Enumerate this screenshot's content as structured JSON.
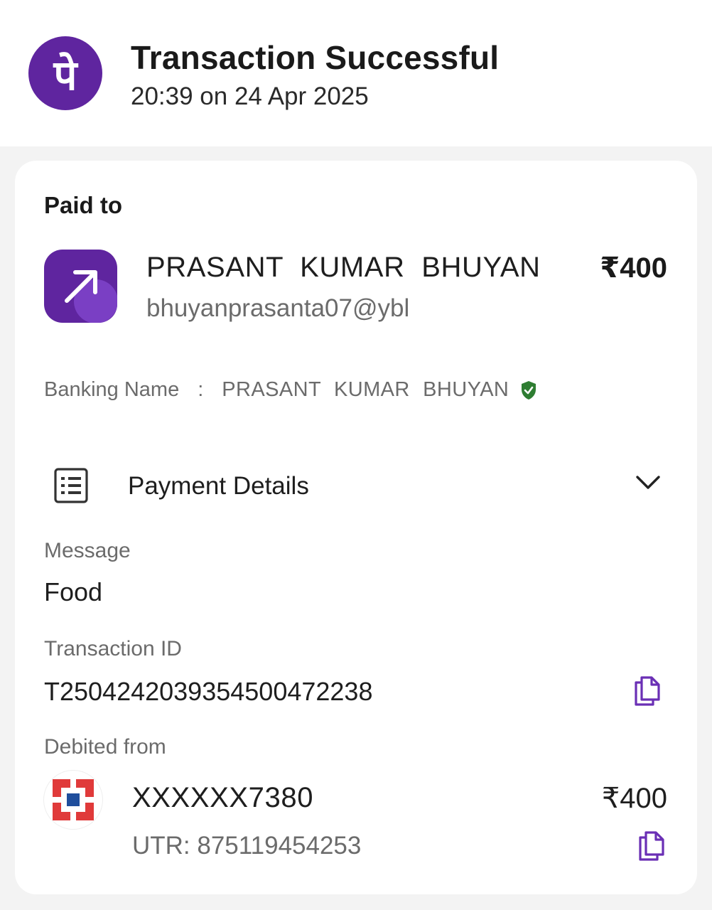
{
  "header": {
    "logo_glyph": "पे",
    "title": "Transaction Successful",
    "datetime": "20:39 on 24 Apr 2025",
    "brand_color": "#5f259f"
  },
  "paid_to": {
    "label": "Paid to",
    "icon": "arrow-up-right-icon",
    "name": "PRASANT KUMAR BHUYAN",
    "upi_id": "bhuyanprasanta07@ybl",
    "amount": "₹400"
  },
  "banking_name": {
    "label": "Banking Name",
    "separator": ":",
    "value": "PRASANT KUMAR BHUYAN",
    "verified_icon": "verified-shield-icon",
    "verified_color": "#2e7d32"
  },
  "payment_details": {
    "label": "Payment Details",
    "icon": "receipt-list-icon",
    "toggle_icon": "chevron-down-icon",
    "message_label": "Message",
    "message_value": "Food",
    "txn_label": "Transaction ID",
    "txn_value": "T2504242039354500472238",
    "debited_label": "Debited from",
    "account": "XXXXXX7380",
    "utr": "UTR: 875119454253",
    "debited_amount": "₹400",
    "bank_icon": "hdfc-bank-logo-icon",
    "copy_icon": "copy-icon"
  }
}
